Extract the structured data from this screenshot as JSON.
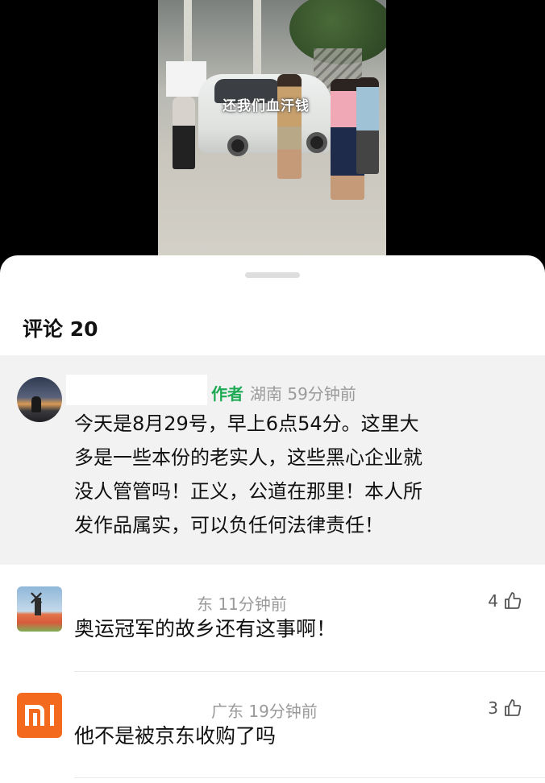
{
  "video": {
    "overlay_caption": "还我们血汗钱"
  },
  "sheet": {
    "title": "评论 20"
  },
  "comments": [
    {
      "author_tag": "作者",
      "location_time": "湖南 59分钟前",
      "text_lines": [
        "今天是8月29号，早上6点54分。这里大",
        "多是一些本份的老实人，这些黑心企业就",
        "没人管管吗！正义，公道在那里！本人所",
        "发作品属实，可以负任何法律责任！"
      ]
    },
    {
      "location_time": "东 11分钟前",
      "text": "奥运冠军的故乡还有这事啊！",
      "likes": "4"
    },
    {
      "location_time": "广东 19分钟前",
      "text": "他不是被京东收购了吗",
      "likes": "3"
    }
  ],
  "colors": {
    "author_tag": "#1eaa55",
    "highlight_bg": "#f2f2f2",
    "meta_gray": "#9a9a9a"
  }
}
